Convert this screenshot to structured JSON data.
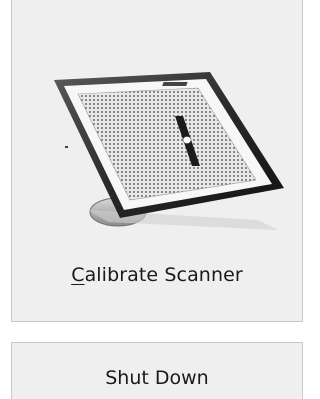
{
  "calibrate_button": {
    "mnemonic": "C",
    "label_rest": "alibrate Scanner",
    "image_icon": "scanner-calibration-icon"
  },
  "shutdown_button": {
    "label": "Shut Down"
  },
  "colors": {
    "button_bg": "#efefef",
    "button_border": "#c9c9c9",
    "text": "#1a1a1a"
  }
}
